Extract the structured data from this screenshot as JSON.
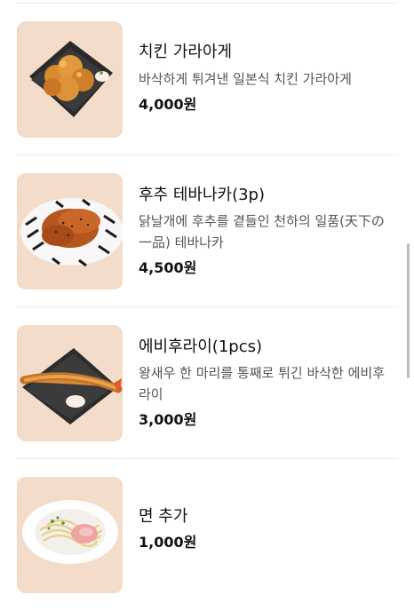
{
  "menu": {
    "items": [
      {
        "name": "치킨 가라아게",
        "description": "바삭하게 튀겨낸 일본식 치킨 가라아게",
        "price": "4,000원",
        "image_icon": "karaage-chicken-image"
      },
      {
        "name": "후추 테바나카(3p)",
        "description": "닭날개에 후추를 곁들인 천하의 일품(天下の一品) 테바나카",
        "price": "4,500원",
        "image_icon": "pepper-tebanaka-image"
      },
      {
        "name": "에비후라이(1pcs)",
        "description": "왕새우 한 마리를 통째로 튀긴 바삭한 에비후라이",
        "price": "3,000원",
        "image_icon": "ebi-fry-image"
      },
      {
        "name": "면 추가",
        "description": "",
        "price": "1,000원",
        "image_icon": "extra-noodles-image"
      }
    ]
  },
  "colors": {
    "background": "#ffffff",
    "divider": "#ececec",
    "description_text": "#555555",
    "thumbnail_background": "#f3d9c7"
  }
}
